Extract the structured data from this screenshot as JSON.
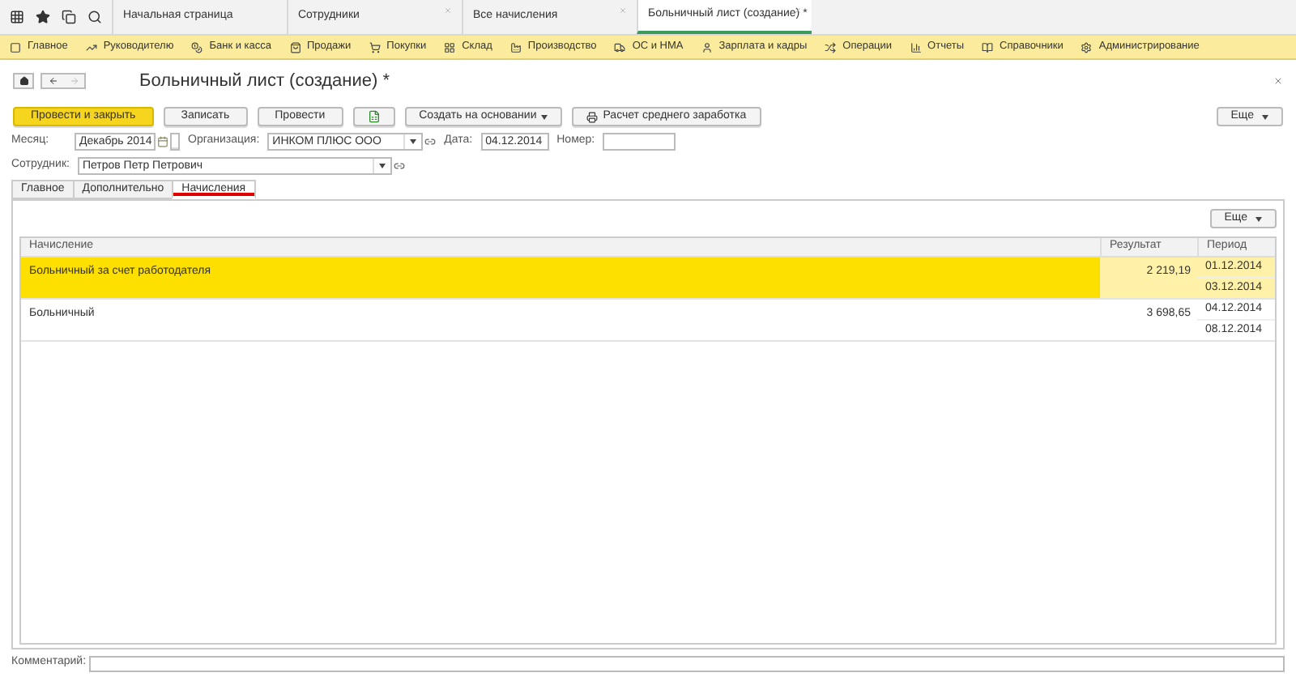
{
  "app_tabs": [
    {
      "label": "Начальная страница",
      "selected": false,
      "closable": false
    },
    {
      "label": "Сотрудники",
      "selected": false,
      "closable": true
    },
    {
      "label": "Все начисления",
      "selected": false,
      "closable": true
    },
    {
      "label": "Больничный лист (создание) *",
      "selected": true,
      "closable": true
    }
  ],
  "sections": [
    "Главное",
    "Руководителю",
    "Банк и касса",
    "Продажи",
    "Покупки",
    "Склад",
    "Производство",
    "ОС и НМА",
    "Зарплата и кадры",
    "Операции",
    "Отчеты",
    "Справочники",
    "Администрирование"
  ],
  "form": {
    "title": "Больничный лист (создание) *",
    "toolbar": [
      {
        "kind": "primary",
        "label": "Провести и закрыть"
      },
      {
        "kind": "normal",
        "label": "Записать"
      },
      {
        "kind": "normal",
        "label": "Провести"
      },
      {
        "kind": "icon"
      },
      {
        "kind": "dropdown",
        "label": "Создать на основании"
      },
      {
        "kind": "printer",
        "label": "Расчет среднего заработка"
      }
    ],
    "more_button": "Еще",
    "month": {
      "label": "Месяц:",
      "value": "Декабрь 2014"
    },
    "organization": {
      "label": "Организация:",
      "value": "ИНКОМ ПЛЮС ООО"
    },
    "date": {
      "label": "Дата:",
      "value": "04.12.2014"
    },
    "number": {
      "label": "Номер:"
    },
    "employee": {
      "label": "Сотрудник:",
      "value": "Петров Петр Петрович"
    },
    "tabs": [
      {
        "label": "Главное",
        "selected": false
      },
      {
        "label": "Дополнительно",
        "selected": false
      },
      {
        "label": "Начисления",
        "selected": true
      }
    ],
    "table": {
      "more_button": "Еще",
      "columns": [
        "Начисление",
        "Результат",
        "Период"
      ],
      "rows": [
        {
          "selected": true,
          "accrual": "Больничный за счет работодателя",
          "result": "2 219,19",
          "period_start": "01.12.2014",
          "period_end": "03.12.2014"
        },
        {
          "selected": false,
          "accrual": "Больничный",
          "result": "3 698,65",
          "period_start": "04.12.2014",
          "period_end": "08.12.2014"
        }
      ]
    },
    "comment": {
      "label": "Комментарий:"
    }
  }
}
